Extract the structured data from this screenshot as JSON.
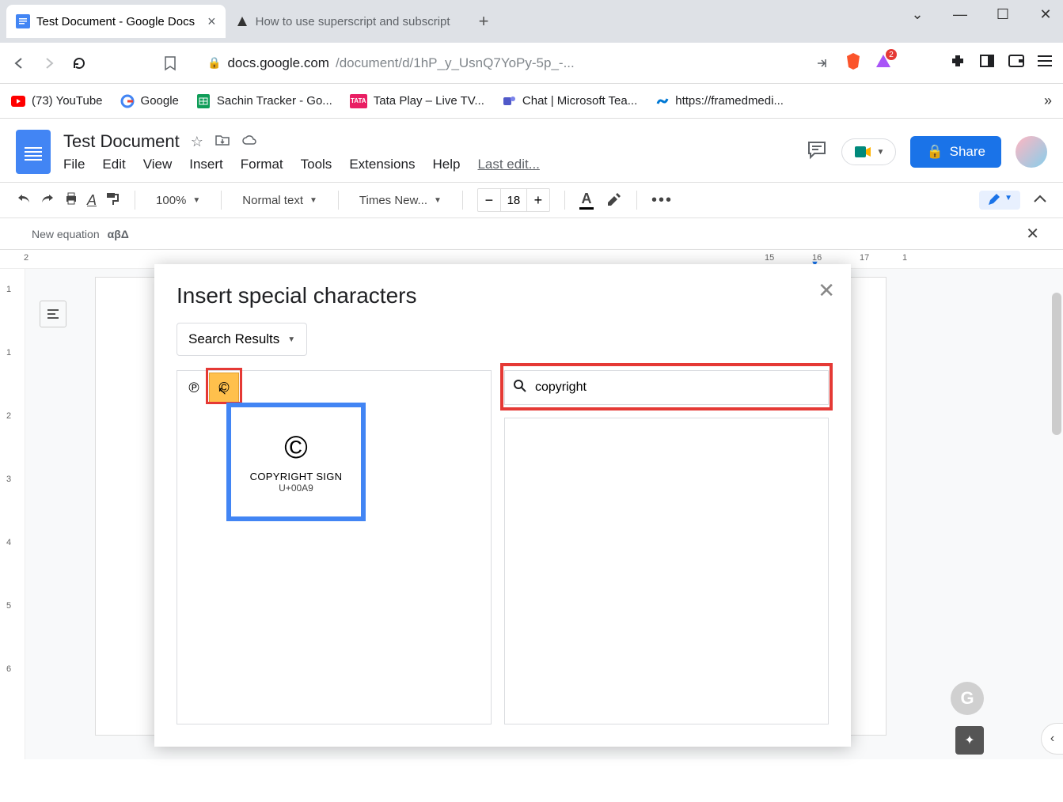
{
  "browser": {
    "tabs": [
      {
        "title": "Test Document - Google Docs",
        "active": true
      },
      {
        "title": "How to use superscript and subscript",
        "active": false
      }
    ],
    "url_primary": "docs.google.com",
    "url_secondary": "/document/d/1hP_y_UsnQ7YoPy-5p_-...",
    "bookmarks": [
      {
        "label": "(73) YouTube"
      },
      {
        "label": "Google"
      },
      {
        "label": "Sachin Tracker - Go..."
      },
      {
        "label": "Tata Play – Live TV..."
      },
      {
        "label": "Chat | Microsoft Tea..."
      },
      {
        "label": "https://framedmedi..."
      }
    ],
    "ext_badge": "2"
  },
  "docs": {
    "title": "Test Document",
    "menubar": [
      "File",
      "Edit",
      "View",
      "Insert",
      "Format",
      "Tools",
      "Extensions",
      "Help"
    ],
    "last_edit": "Last edit...",
    "share_label": "Share",
    "toolbar": {
      "zoom": "100%",
      "style": "Normal text",
      "font": "Times New...",
      "font_size": "18"
    },
    "eq_label": "New equation",
    "eq_symbols": "αβΔ"
  },
  "modal": {
    "title": "Insert special characters",
    "category": "Search Results",
    "search_value": "copyright",
    "results": [
      {
        "glyph": "℗"
      },
      {
        "glyph": "©"
      }
    ],
    "tooltip": {
      "glyph": "©",
      "name": "COPYRIGHT SIGN",
      "code": "U+00A9"
    }
  },
  "ruler_marks": [
    "2",
    "15",
    "16",
    "17",
    "1"
  ],
  "vruler_marks": [
    "1",
    "1",
    "2",
    "3",
    "4",
    "5",
    "6"
  ]
}
